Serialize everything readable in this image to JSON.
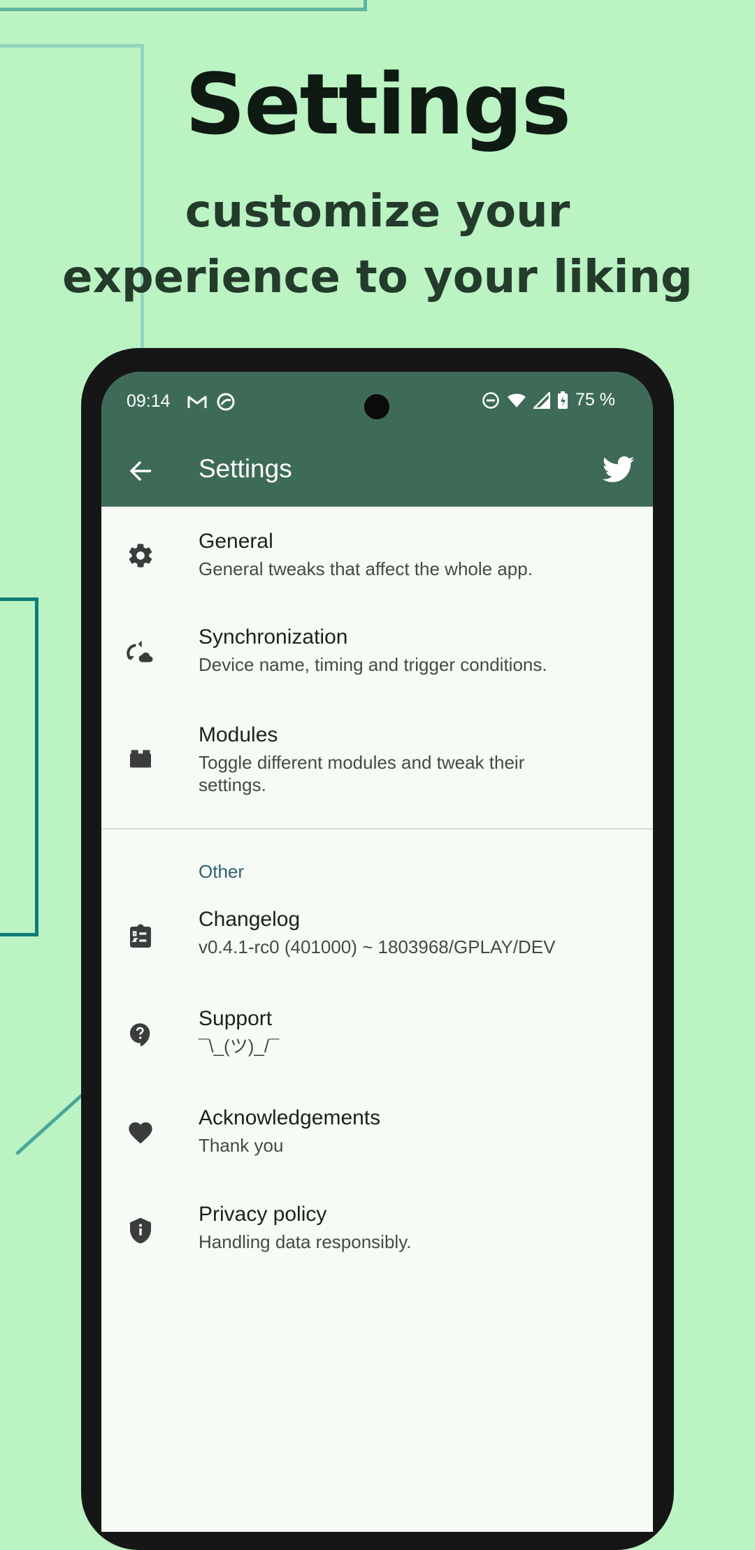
{
  "hero": {
    "title": "Settings",
    "subtitle_line1": "customize your",
    "subtitle_line2": "experience to your liking"
  },
  "status_bar": {
    "time": "09:14",
    "left_icons": [
      "gmail-icon",
      "sync-app-icon"
    ],
    "right_icons": [
      "dnd-icon",
      "wifi-icon",
      "signal-icon",
      "battery-icon"
    ],
    "battery": "75 %"
  },
  "app_bar": {
    "title": "Settings",
    "back_icon": "arrow-back-icon",
    "action_icon": "twitter-icon"
  },
  "items": [
    {
      "title": "General",
      "summary": "General tweaks that affect the whole app.",
      "icon": "gear-icon"
    },
    {
      "title": "Synchronization",
      "summary": "Device name, timing and trigger conditions.",
      "icon": "cloud-sync-icon"
    },
    {
      "title": "Modules",
      "summary": "Toggle different modules and tweak their settings.",
      "icon": "modules-icon"
    }
  ],
  "section_other": "Other",
  "other_items": [
    {
      "title": "Changelog",
      "summary": "v0.4.1-rc0 (401000) ~ 1803968/GPLAY/DEV",
      "icon": "changelog-icon"
    },
    {
      "title": "Support",
      "summary": "¯\\_(ツ)_/¯",
      "icon": "help-icon"
    },
    {
      "title": "Acknowledgements",
      "summary": "Thank you",
      "icon": "heart-icon"
    },
    {
      "title": "Privacy policy",
      "summary": "Handling data responsibly.",
      "icon": "shield-icon"
    }
  ],
  "colors": {
    "background": "#bbf3c3",
    "app_bar": "#3e6b58",
    "screen": "#f7fbf5",
    "section_header": "#2f5d72"
  }
}
